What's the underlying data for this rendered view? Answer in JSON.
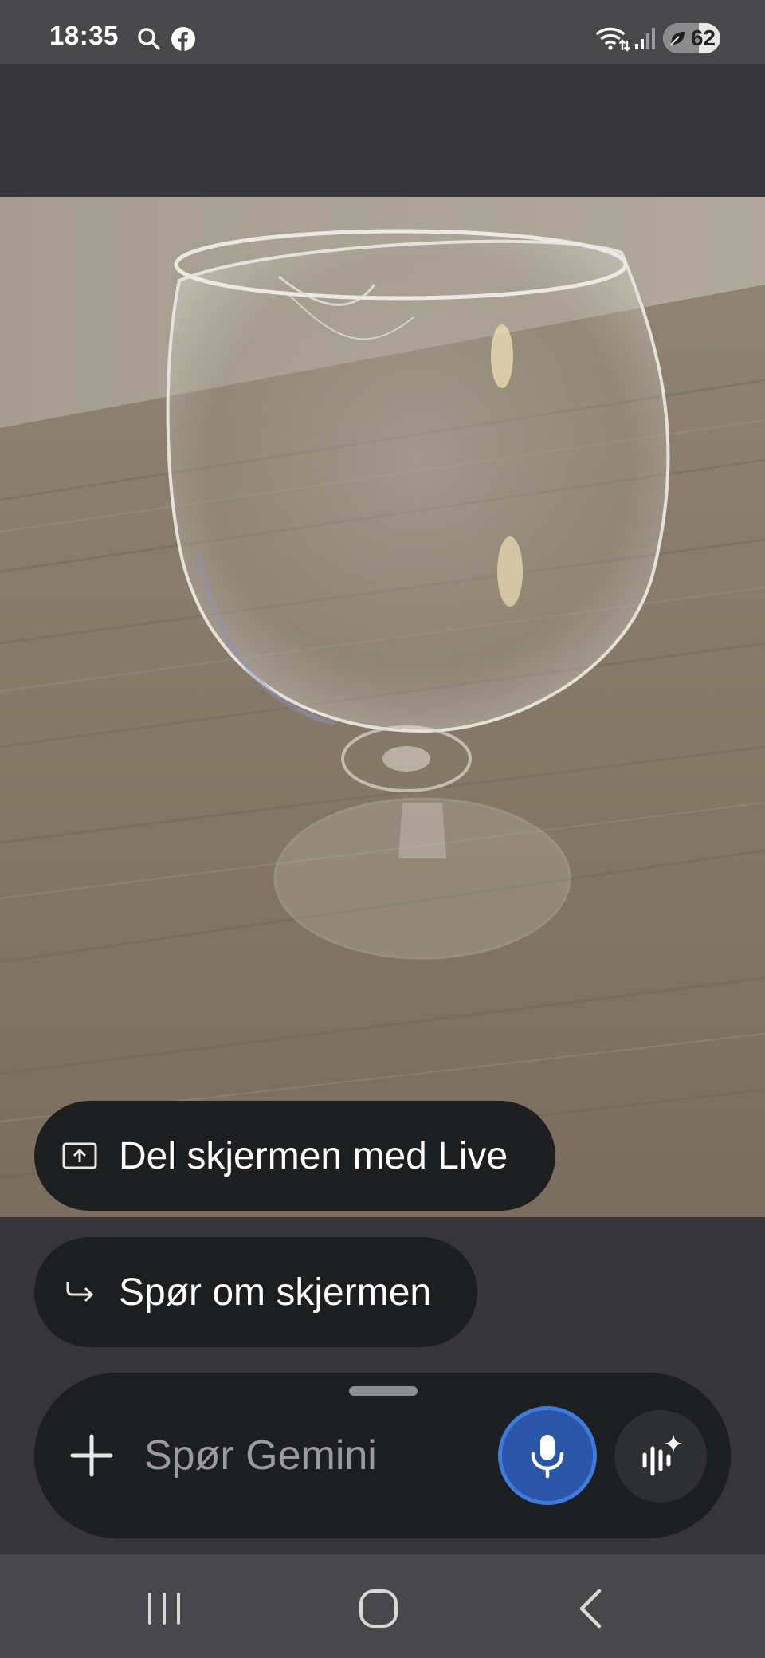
{
  "status_bar": {
    "time": "18:35",
    "icons": [
      "search-icon",
      "facebook-icon",
      "wifi-icon",
      "signal-icon",
      "battery-icon"
    ],
    "battery_level": "62",
    "battery_fraction": 0.62
  },
  "camera": {
    "subject": "crystal-snifter-glass-photo"
  },
  "actions": {
    "share_screen_label": "Del skjermen med Live",
    "share_screen_icon": "screen-share-icon",
    "ask_screen_label": "Spør om skjermen",
    "ask_screen_icon": "reply-arrow-icon"
  },
  "composer": {
    "placeholder": "Spør Gemini",
    "value": "",
    "add_icon": "plus-icon",
    "mic_icon": "microphone-icon",
    "live_icon": "gemini-live-icon"
  },
  "nav_bar": {
    "icons": [
      "recent-apps-icon",
      "home-icon",
      "back-icon"
    ]
  },
  "colors": {
    "chip_bg": "#1d1e20",
    "mic_bg": "#2b55a6",
    "mic_border": "#3d7bdd",
    "system_bar": "#48484a"
  }
}
